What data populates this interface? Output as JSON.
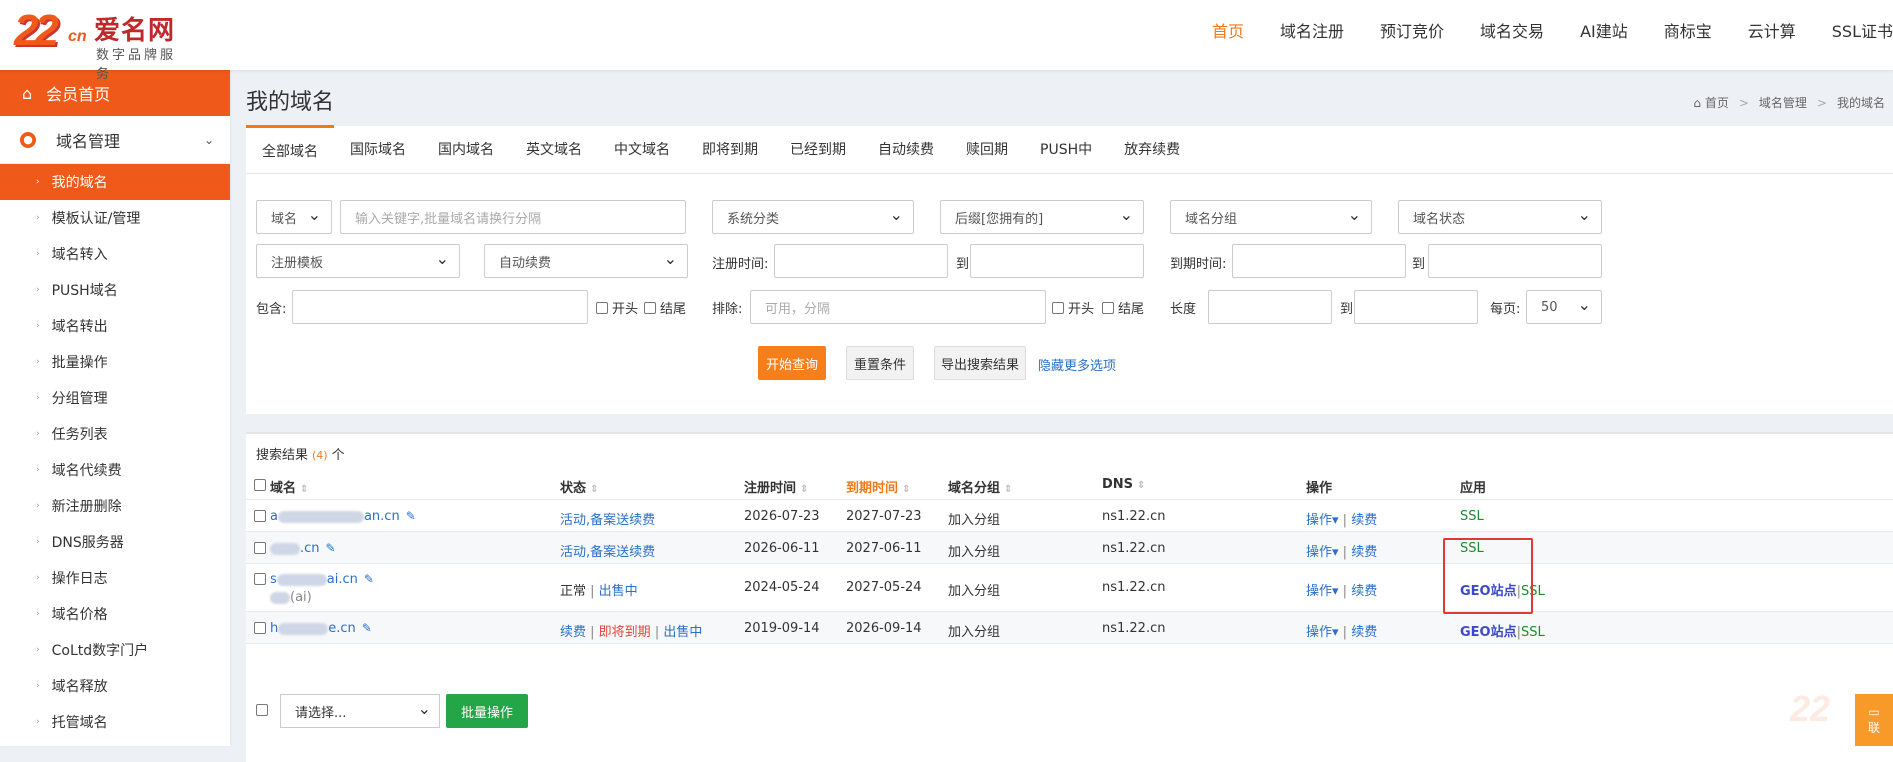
{
  "logo": {
    "mark": "22",
    "cn": "cn",
    "name": "爱名网",
    "sub": "数字品牌服务"
  },
  "topnav": [
    "首页",
    "域名注册",
    "预订竞价",
    "域名交易",
    "AI建站",
    "商标宝",
    "云计算",
    "SSL证书"
  ],
  "sidebar": {
    "home": "会员首页",
    "group": "域名管理",
    "items": [
      "我的域名",
      "模板认证/管理",
      "域名转入",
      "PUSH域名",
      "域名转出",
      "批量操作",
      "分组管理",
      "任务列表",
      "域名代续费",
      "新注册删除",
      "DNS服务器",
      "操作日志",
      "域名价格",
      "CoLtd数字门户",
      "域名释放",
      "托管域名"
    ]
  },
  "page": {
    "title": "我的域名",
    "breadcrumb": [
      "首页",
      "域名管理",
      "我的域名"
    ]
  },
  "tabs": [
    "全部域名",
    "国际域名",
    "国内域名",
    "英文域名",
    "中文域名",
    "即将到期",
    "已经到期",
    "自动续费",
    "赎回期",
    "PUSH中",
    "放弃续费"
  ],
  "filters": {
    "domain_type": "域名",
    "keyword_placeholder": "输入关键字,批量域名请换行分隔",
    "category": "系统分类",
    "suffix": "后缀[您拥有的]",
    "group": "域名分组",
    "status": "域名状态",
    "template": "注册模板",
    "autorenew": "自动续费",
    "reg_time_label": "注册时间:",
    "to": "到",
    "exp_time_label": "到期时间:",
    "contain_label": "包含:",
    "start_label": "开头",
    "end_label": "结尾",
    "exclude_label": "排除:",
    "exclude_placeholder": "可用，分隔",
    "length_label": "长度",
    "perpage_label": "每页:",
    "perpage": "50",
    "search_btn": "开始查询",
    "reset_btn": "重置条件",
    "export_btn": "导出搜索结果",
    "hide_more": "隐藏更多选项"
  },
  "results": {
    "label": "搜索结果",
    "count": "(4)",
    "unit": "个",
    "columns": [
      "域名",
      "状态",
      "注册时间",
      "到期时间",
      "域名分组",
      "DNS",
      "操作",
      "应用"
    ],
    "rows": [
      {
        "domain_prefix": "a",
        "domain_suffix": "an.cn",
        "sub": "",
        "status": [
          {
            "t": "活动,备案送续费",
            "c": "blue"
          }
        ],
        "reg": "2026-07-23",
        "exp": "2027-07-23",
        "group": "加入分组",
        "dns": "ns1.22.cn",
        "op": "操作",
        "renew": "续费",
        "apps": [
          {
            "t": "SSL",
            "c": "green"
          }
        ]
      },
      {
        "domain_prefix": "",
        "domain_suffix": ".cn",
        "sub": "",
        "status": [
          {
            "t": "活动,备案送续费",
            "c": "blue"
          }
        ],
        "reg": "2026-06-11",
        "exp": "2027-06-11",
        "group": "加入分组",
        "dns": "ns1.22.cn",
        "op": "操作",
        "renew": "续费",
        "apps": [
          {
            "t": "SSL",
            "c": "green"
          }
        ]
      },
      {
        "domain_prefix": "s",
        "domain_suffix": "ai.cn",
        "sub": "(ai)",
        "status": [
          {
            "t": "正常",
            "c": "dark"
          },
          {
            "t": "出售中",
            "c": "blue"
          }
        ],
        "reg": "2024-05-24",
        "exp": "2027-05-24",
        "group": "加入分组",
        "dns": "ns1.22.cn",
        "op": "操作",
        "renew": "续费",
        "apps": [
          {
            "t": "GEO站点",
            "c": "geo"
          },
          {
            "t": "SSL",
            "c": "green"
          }
        ]
      },
      {
        "domain_prefix": "h",
        "domain_suffix": "e.cn",
        "sub": "",
        "status": [
          {
            "t": "续费",
            "c": "blue"
          },
          {
            "t": "即将到期",
            "c": "red"
          },
          {
            "t": "出售中",
            "c": "blue"
          }
        ],
        "reg": "2019-09-14",
        "exp": "2026-09-14",
        "group": "加入分组",
        "dns": "ns1.22.cn",
        "op": "操作",
        "renew": "续费",
        "apps": [
          {
            "t": "GEO站点",
            "c": "geo"
          },
          {
            "t": "SSL",
            "c": "green"
          }
        ]
      }
    ]
  },
  "bulk": {
    "select_placeholder": "请选择...",
    "button": "批量操作"
  },
  "chat": {
    "label": "联"
  }
}
